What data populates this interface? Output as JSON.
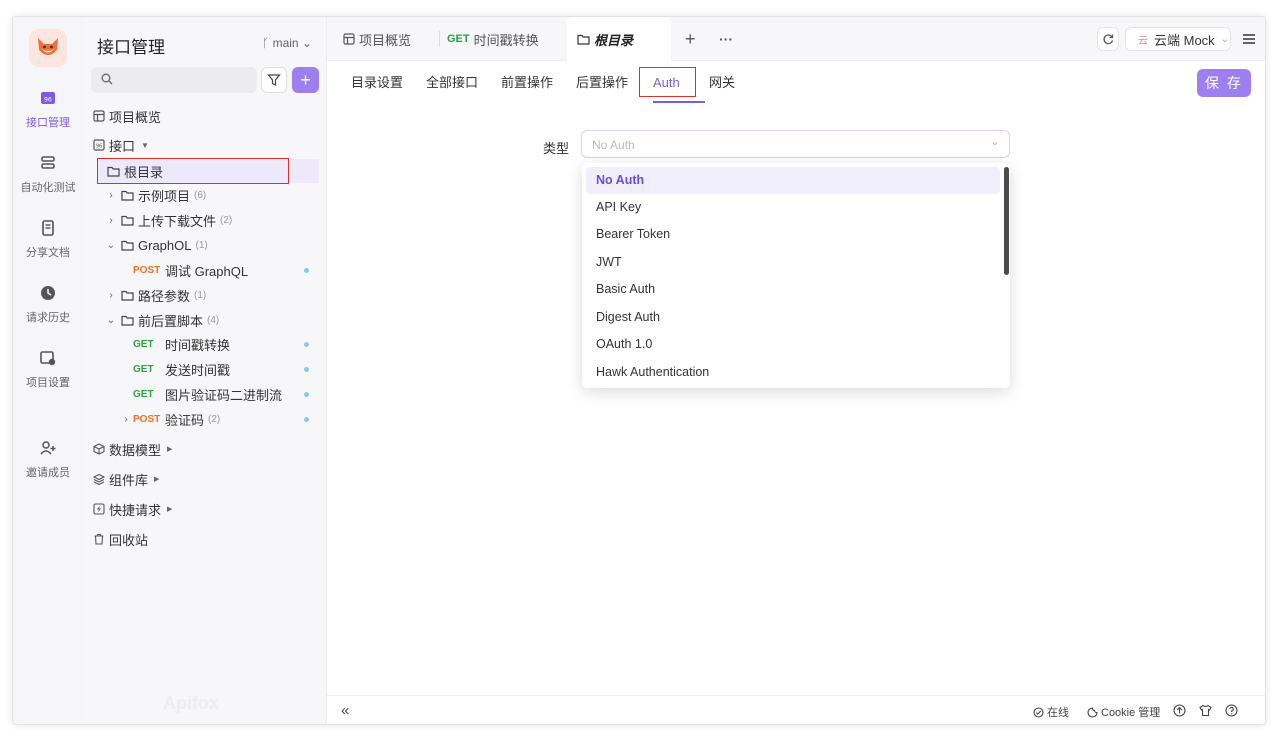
{
  "rail": {
    "items": [
      {
        "label": "接口管理",
        "icon": "api-icon"
      },
      {
        "label": "自动化测试",
        "icon": "automation-icon"
      },
      {
        "label": "分享文档",
        "icon": "share-doc-icon"
      },
      {
        "label": "请求历史",
        "icon": "history-icon"
      },
      {
        "label": "项目设置",
        "icon": "settings-icon"
      },
      {
        "label": "邀请成员",
        "icon": "invite-icon"
      }
    ]
  },
  "sidebar": {
    "title": "接口管理",
    "branch": "main",
    "add_label": "+",
    "tree": {
      "overview": "项目概览",
      "api": "接口",
      "root": "根目录",
      "example": {
        "label": "示例项目",
        "count": "(6)"
      },
      "upload": {
        "label": "上传下载文件",
        "count": "(2)"
      },
      "graphql": {
        "label": "GraphOL",
        "count": "(1)"
      },
      "graphql_req": {
        "method": "POST",
        "label": "调试 GraphQL"
      },
      "path_params": {
        "label": "路径参数",
        "count": "(1)"
      },
      "scripts": {
        "label": "前后置脚本",
        "count": "(4)"
      },
      "s1": {
        "method": "GET",
        "label": "时间戳转换"
      },
      "s2": {
        "method": "GET",
        "label": "发送时间戳"
      },
      "s3": {
        "method": "GET",
        "label": "图片验证码二进制流"
      },
      "s4": {
        "method": "POST",
        "label": "验证码",
        "count": "(2)"
      },
      "models": "数据模型",
      "components": "组件库",
      "quick": "快捷请求",
      "trash": "回收站"
    },
    "watermark": "Apifox"
  },
  "tabs": {
    "overview": "项目概览",
    "get_method": "GET",
    "timestamp": "时间戳转换",
    "root": "根目录",
    "add": "+",
    "more": "···",
    "env": "云端 Mock",
    "env_badge": "云"
  },
  "subtabs": [
    "目录设置",
    "全部接口",
    "前置操作",
    "后置操作",
    "Auth",
    "网关"
  ],
  "save_label": "保 存",
  "auth": {
    "type_label": "类型",
    "placeholder": "No Auth",
    "options": [
      "No Auth",
      "API Key",
      "Bearer Token",
      "JWT",
      "Basic Auth",
      "Digest Auth",
      "OAuth 1.0",
      "Hawk Authentication"
    ],
    "selected": "No Auth"
  },
  "footer": {
    "collapse": "«",
    "online": "在线",
    "cookie": "Cookie 管理"
  },
  "colors": {
    "accent": "#9e7ff0",
    "get": "#2ea043",
    "post": "#f07020",
    "highlight": "#d9302c"
  }
}
